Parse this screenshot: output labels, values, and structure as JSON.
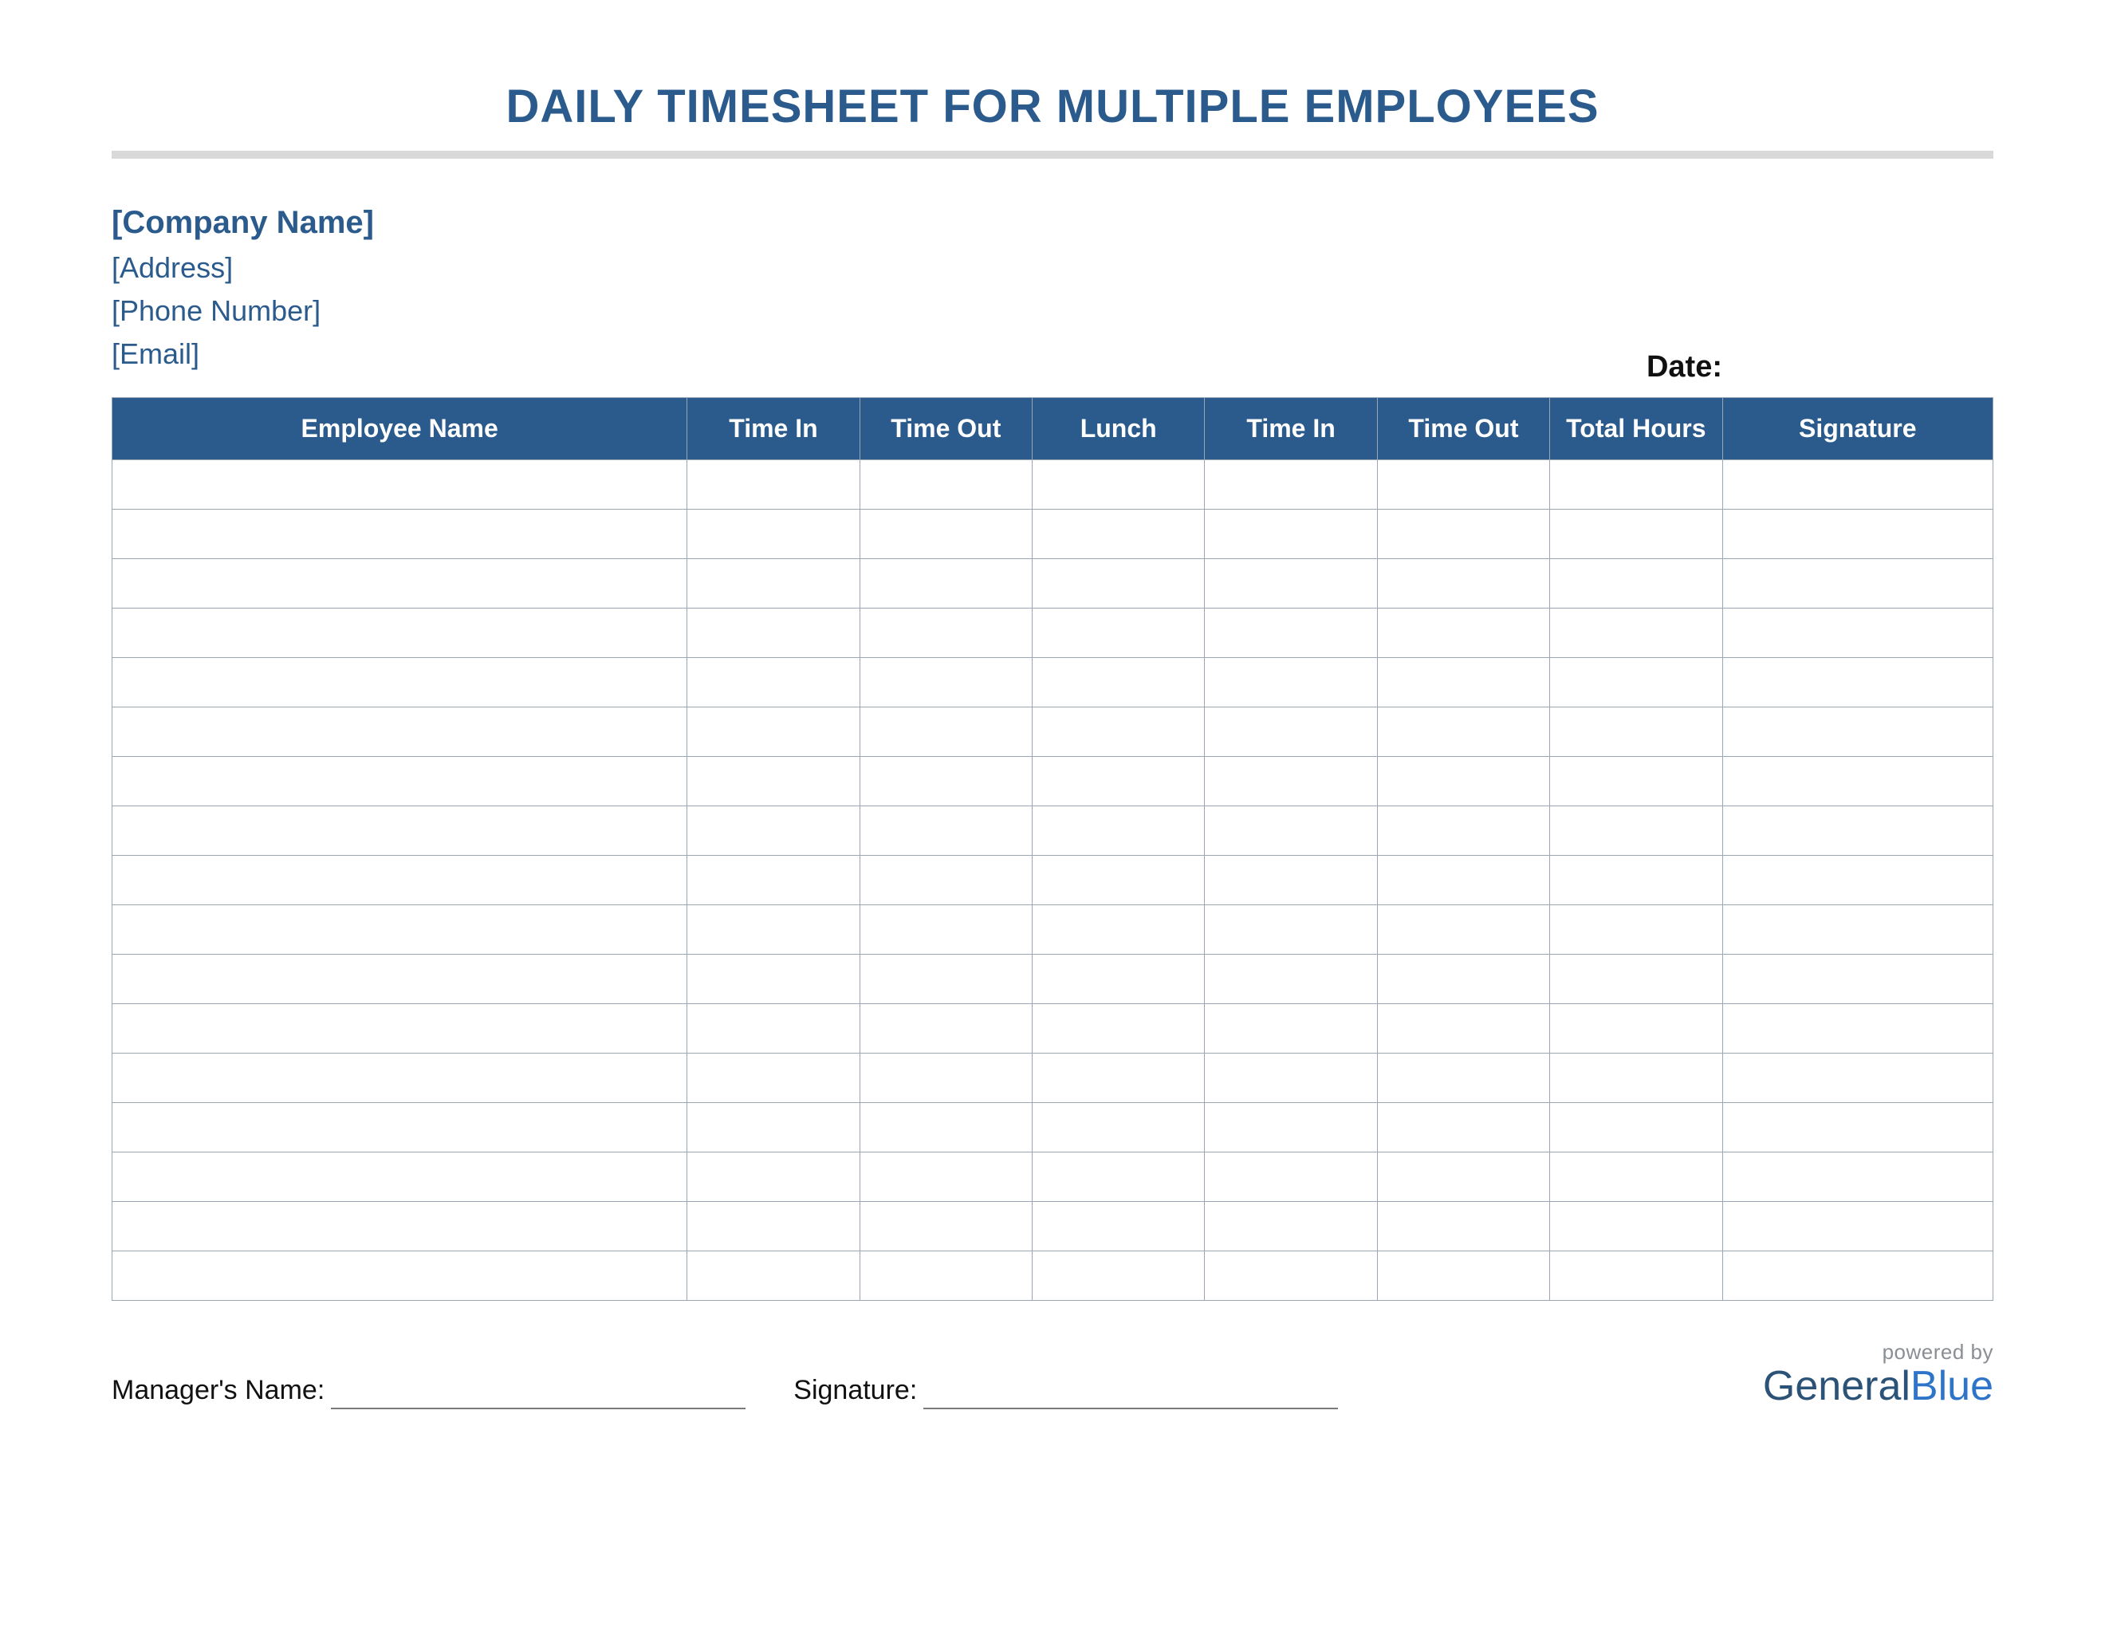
{
  "title": "DAILY TIMESHEET FOR MULTIPLE EMPLOYEES",
  "company": {
    "name": "[Company Name]",
    "address": "[Address]",
    "phone": "[Phone Number]",
    "email": "[Email]"
  },
  "date_label": "Date:",
  "columns": [
    "Employee Name",
    "Time In",
    "Time Out",
    "Lunch",
    "Time In",
    "Time Out",
    "Total Hours",
    "Signature"
  ],
  "row_count": 17,
  "footer": {
    "manager_label": "Manager's Name:",
    "signature_label": "Signature:"
  },
  "brand": {
    "powered": "powered by",
    "name_part1": "General",
    "name_part2": "Blue"
  },
  "colors": {
    "accent": "#2b5b8c",
    "rule": "#d9d9d9",
    "border": "#9aa6b2"
  }
}
